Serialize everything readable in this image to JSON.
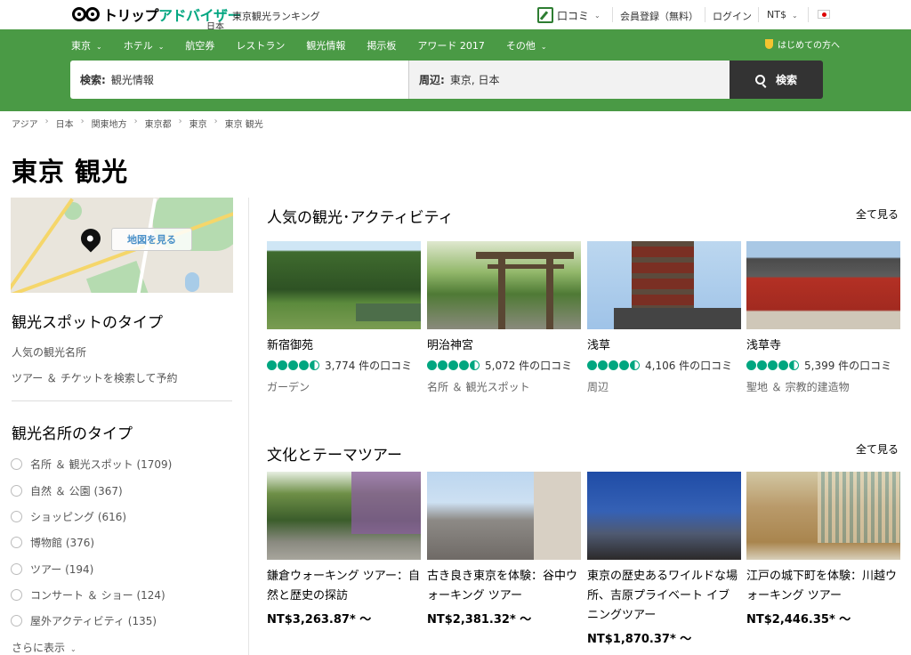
{
  "topbar": {
    "brand_a": "トリップ",
    "brand_b": "アドバイザー",
    "brand_sub": "日本",
    "ranking": "東京観光ランキング",
    "review": "口コミ",
    "register": "会員登録（無料）",
    "login": "ログイン",
    "currency": "NT$"
  },
  "nav": {
    "items": [
      "東京",
      "ホテル",
      "航空券",
      "レストラン",
      "観光情報",
      "掲示板",
      "アワード 2017",
      "その他"
    ],
    "first_visit": "はじめての方へ"
  },
  "search": {
    "label": "検索:",
    "value": "観光情報",
    "near_label": "周辺:",
    "near_value": "東京, 日本",
    "button": "検索"
  },
  "breadcrumb": [
    "アジア",
    "日本",
    "関東地方",
    "東京都",
    "東京",
    "東京 観光"
  ],
  "page_title": "東京 観光",
  "sidebar": {
    "map_button": "地図を見る",
    "types_heading": "観光スポットのタイプ",
    "links": [
      "人気の観光名所",
      "ツアー ＆ チケットを検索して予約"
    ],
    "attr_heading": "観光名所のタイプ",
    "filters": [
      "名所 ＆ 観光スポット (1709)",
      "自然 ＆ 公園 (367)",
      "ショッピング (616)",
      "博物館 (376)",
      "ツアー (194)",
      "コンサート ＆ ショー (124)",
      "屋外アクティビティ (135)"
    ],
    "more": "さらに表示"
  },
  "popular": {
    "title": "人気の観光･アクティビティ",
    "see_all": "全て見る",
    "cards": [
      {
        "name": "新宿御苑",
        "reviews": "3,774 件の口コミ",
        "category": "ガーデン",
        "rating": 4.5
      },
      {
        "name": "明治神宮",
        "reviews": "5,072 件の口コミ",
        "category": "名所 ＆ 観光スポット",
        "rating": 4.5
      },
      {
        "name": "浅草",
        "reviews": "4,106 件の口コミ",
        "category": "周辺",
        "rating": 4.5
      },
      {
        "name": "浅草寺",
        "reviews": "5,399 件の口コミ",
        "category": "聖地 ＆ 宗教的建造物",
        "rating": 4.5
      }
    ]
  },
  "tours": {
    "title": "文化とテーマツアー",
    "see_all": "全て見る",
    "cards": [
      {
        "name": "鎌倉ウォーキング ツアー：自然と歴史の探訪",
        "price": "NT$3,263.87* 〜"
      },
      {
        "name": "古き良き東京を体験：谷中ウォーキング ツアー",
        "price": "NT$2,381.32* 〜"
      },
      {
        "name": "東京の歴史あるワイルドな場所、吉原プライベート イブニングツアー",
        "price": "NT$1,870.37* 〜"
      },
      {
        "name": "江戸の城下町を体験：川越ウォーキング ツアー",
        "price": "NT$2,446.35* 〜"
      }
    ]
  },
  "colors": {
    "green_header": "#4a9a45",
    "bubble": "#00a680",
    "search_button": "#333333"
  }
}
